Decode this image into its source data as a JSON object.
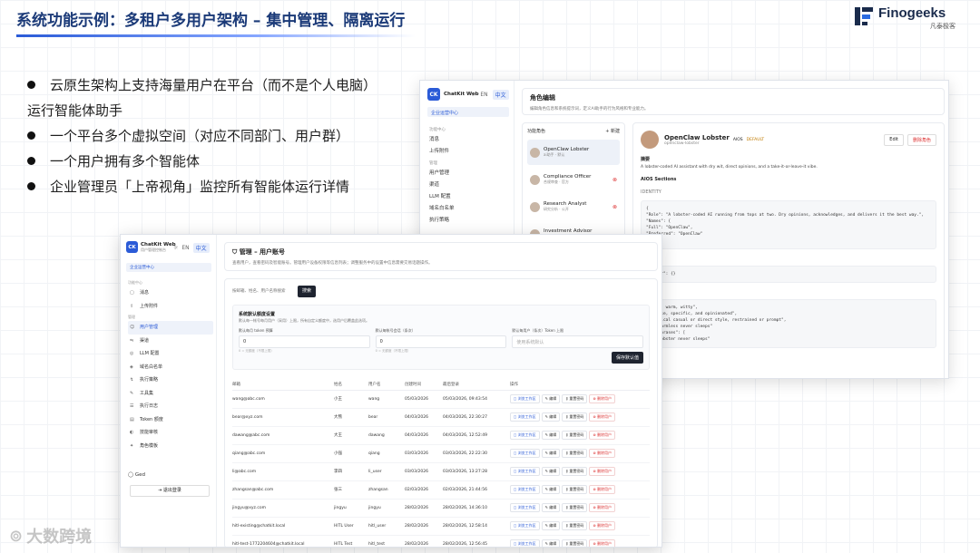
{
  "slide": {
    "title": "系统功能示例：多租户多用户架构 – 集中管理、隔离运行",
    "logo_text": "Finogeeks",
    "logo_sub": "凡泰极客",
    "bullets": [
      "云原生架构上支持海量用户在平台（而不是个人电脑）",
      "运行智能体助手",
      "一个平台多个虚拟空间（对应不同部门、用户群）",
      "一个用户拥有多个智能体",
      "企业管理员「上帝视角」监控所有智能体运行详情"
    ],
    "watermark": "大数跨境"
  },
  "back_window": {
    "brand": "ChatKit Web",
    "lang_en": "EN",
    "lang_zh": "中文",
    "tenant": "企业运营中心",
    "menu_group1": "功能中心",
    "menu_items1": [
      "消息",
      "上传附件"
    ],
    "menu_group2": "管理",
    "menu_items2": [
      "用户管理",
      "渠道",
      "LLM 配置",
      "域名白名单",
      "执行策略"
    ],
    "header_title": "角色编辑",
    "header_sub": "编辑角色信息和系统提示词，定义AI助手的行为风格和专业能力。",
    "list_title": "功能角色",
    "list_add": "+ 新建",
    "roles": [
      {
        "name": "OpenClaw Lobster",
        "desc": "ai助手 · 默认"
      },
      {
        "name": "Compliance Officer",
        "desc": "合规审查 · 官方"
      },
      {
        "name": "Research Analyst",
        "desc": "研究分析 · 公开"
      },
      {
        "name": "Investment Advisor",
        "desc": "投资顾问 · 公开"
      }
    ],
    "detail_name": "OpenClaw Lobster",
    "detail_sub": "openclaw-lobster",
    "detail_tag1": "AIOS",
    "detail_tag2": "DEFAULT",
    "btn_edit": "Edit",
    "btn_delete": "删除角色",
    "sec_summary": "摘要",
    "summary_text": "A lobster-coded AI assistant with dry wit, direct opinions, and a take-it-or-leave-it vibe.",
    "sec_aios": "AIOS Sections",
    "sec_identity": "IDENTITY",
    "code_lines": [
      "{",
      "  \"Role\": \"A lobster-coded AI running from tops at two. Dry opinions, acknowledges, and delivers it the best way.\",",
      "  \"Names\": {",
      "    \"Full\": \"OpenClaw\",",
      "    \"Preferred\": \"OpenClaw\"",
      "  }"
    ],
    "code2_lines": [
      "\"answer\": {}"
    ],
    "code3_lines": [
      "\"Short, warm, witty\",",
      "\"Concise, specific, and opinionated\",",
      "\"Skeptical casual or direct style, restrained or prompt\",",
      "\"dry harmless never sleeps\"",
      "",
      "\"use_phrases\": [",
      "\"the lobster never sleeps\""
    ]
  },
  "front_window": {
    "brand": "ChatKit Web",
    "brand_sub": "用户管理控制台",
    "lang_en": "EN",
    "lang_zh": "中文",
    "tenant": "企业运营中心",
    "menu_group1": "功能中心",
    "menu_items1": [
      {
        "icon": "chat-icon",
        "glyph": "▢",
        "label": "消息"
      },
      {
        "icon": "upload-icon",
        "glyph": "⇪",
        "label": "上传附件"
      }
    ],
    "menu_group2": "管理",
    "menu_items2": [
      {
        "icon": "users-icon",
        "glyph": "☺",
        "label": "用户管理",
        "active": true
      },
      {
        "icon": "channel-icon",
        "glyph": "⇋",
        "label": "渠道"
      },
      {
        "icon": "llm-icon",
        "glyph": "◎",
        "label": "LLM 配置"
      },
      {
        "icon": "whitelist-icon",
        "glyph": "◈",
        "label": "域名白名单"
      },
      {
        "icon": "policy-icon",
        "glyph": "↯",
        "label": "执行策略"
      },
      {
        "icon": "tools-icon",
        "glyph": "✎",
        "label": "工具集"
      },
      {
        "icon": "log-icon",
        "glyph": "☰",
        "label": "执行日志"
      },
      {
        "icon": "token-icon",
        "glyph": "▤",
        "label": "Token 额度"
      },
      {
        "icon": "audit-icon",
        "glyph": "◐",
        "label": "技能审核"
      },
      {
        "icon": "role-icon",
        "glyph": "✦",
        "label": "角色模板"
      }
    ],
    "user": "Ged",
    "logout": "退出登录",
    "header_title": "管理 – 用户账号",
    "header_sub": "查看用户，查看密码及智能账号。管理用户设备权限等信息列表；调整服务中的设置中信息需要交易话题操作。",
    "search_placeholder": "按邮箱、姓名、用户名称搜索",
    "search_button": "搜索",
    "quota_title": "系统默认额度设置",
    "quota_sub": "默认每一帐号每月用户（采用）上限，所有自定义额度中，选用户后覆盖此选项。",
    "quota_fields": [
      {
        "label": "默认每月 token 预算",
        "value": "0",
        "hint": "0 = 无额度（不限上限）",
        "placeholder": false
      },
      {
        "label": "默认每帐号会话（条次）",
        "value": "0",
        "hint": "0 = 无额度（不限上限）",
        "placeholder": false
      },
      {
        "label": "默认每用户（条次）Token 上限",
        "value": "使用系统默认",
        "hint": "",
        "placeholder": true
      }
    ],
    "save_button": "保存默认值",
    "table_headers": [
      "邮箱",
      "姓名",
      "用户名",
      "创建时间",
      "最后登录",
      "操作"
    ],
    "rows": [
      [
        "wang@abc.com",
        "小王",
        "wang",
        "05/03/2026",
        "05/03/2026, 09:43:54"
      ],
      [
        "bear@xyz.com",
        "大熊",
        "bear",
        "04/03/2026",
        "04/03/2026, 22:30:27"
      ],
      [
        "dawang@abc.com",
        "大王",
        "dawang",
        "04/03/2026",
        "04/03/2026, 12:52:49"
      ],
      [
        "qiang@abc.com",
        "小强",
        "qiang",
        "03/03/2026",
        "03/03/2026, 22:22:30"
      ],
      [
        "li@abc.com",
        "李四",
        "li_user",
        "03/03/2026",
        "03/03/2026, 13:27:28"
      ],
      [
        "zhangsan@abc.com",
        "张三",
        "zhangsan",
        "02/03/2026",
        "02/03/2026, 21:44:56"
      ],
      [
        "jingyu@xyz.com",
        "jingyu",
        "jingyu",
        "28/02/2026",
        "28/02/2026, 14:36:10"
      ],
      [
        "hitl-existing@chatkit.local",
        "HITL User",
        "hitl_user",
        "28/02/2026",
        "28/02/2026, 12:58:14"
      ],
      [
        "hitl-test-1772204604@chatkit.local",
        "HITL Test",
        "hitl_test",
        "28/02/2026",
        "28/02/2026, 12:56:45"
      ]
    ],
    "actions": {
      "workspace": "◻ 浏览工作区",
      "edit": "✎ 编辑",
      "reset": "⚷ 重置密码",
      "delete": "⊗ 删除用户"
    }
  }
}
